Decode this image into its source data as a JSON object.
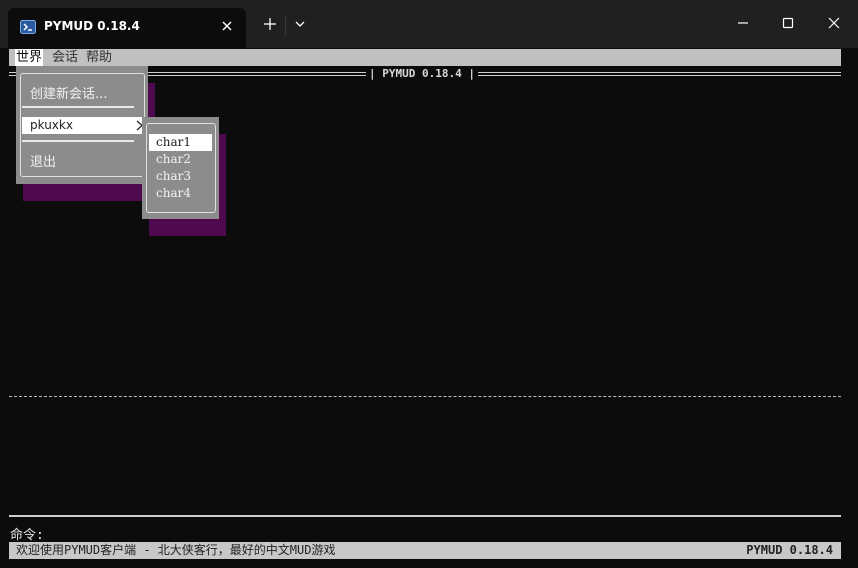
{
  "window": {
    "tab_title": "PYMUD 0.18.4",
    "tab_icon": "powershell-icon",
    "controls": [
      "minimize-icon",
      "maximize-icon",
      "close-icon"
    ]
  },
  "menubar": {
    "items": [
      "世界",
      "会话",
      "帮助"
    ],
    "active": "世界"
  },
  "frame_title": "| PYMUD 0.18.4 |",
  "world_menu": {
    "new_session": "创建新会话...",
    "server": "pkuxkx",
    "exit": "退出"
  },
  "char_menu": {
    "items": [
      "char1",
      "char2",
      "char3",
      "char4"
    ],
    "selected": "char1"
  },
  "command": {
    "prompt": "命令:"
  },
  "status": {
    "left": "欢迎使用PYMUD客户端 - 北大侠客行，最好的中文MUD游戏",
    "right": "PYMUD 0.18.4"
  },
  "colors": {
    "background": "#0c0c0c",
    "menu_bg": "#8c8c8c",
    "menu_shadow": "#4f0a4f",
    "bar_bg": "#c0c0c0"
  }
}
